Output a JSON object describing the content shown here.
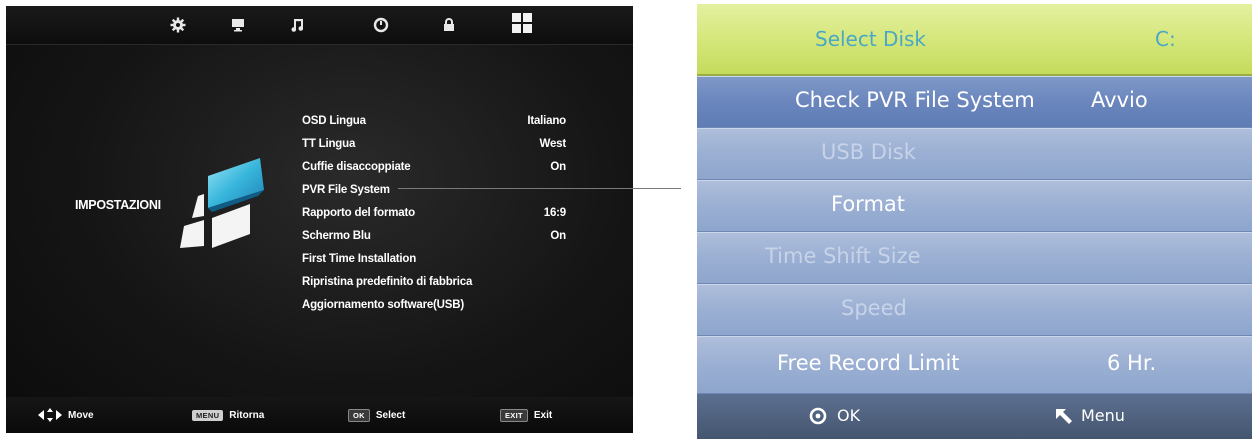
{
  "tv_screen": {
    "top_icons": [
      "gear-icon",
      "monitor-icon",
      "music-note-icon",
      "clock-icon",
      "lock-icon",
      "grid-icon"
    ],
    "section_title": "IMPOSTAZIONI",
    "menu": [
      {
        "label": "OSD Lingua",
        "value": "Italiano"
      },
      {
        "label": "TT Lingua",
        "value": "West"
      },
      {
        "label": "Cuffie disaccoppiate",
        "value": "On"
      },
      {
        "label": "PVR File System",
        "value": ""
      },
      {
        "label": "Rapporto del formato",
        "value": "16:9"
      },
      {
        "label": "Schermo Blu",
        "value": "On"
      },
      {
        "label": "First Time Installation",
        "value": ""
      },
      {
        "label": "Ripristina predefinito di fabbrica",
        "value": ""
      },
      {
        "label": "Aggiornamento software(USB)",
        "value": ""
      }
    ],
    "bottom_bar": {
      "move": "Move",
      "menu_key": "MENU",
      "menu_label": "Ritorna",
      "ok_key": "OK",
      "ok_label": "Select",
      "exit_key": "EXIT",
      "exit_label": "Exit"
    }
  },
  "pvr_panel": {
    "header": {
      "label": "Select Disk",
      "value": "C:"
    },
    "rows": [
      {
        "label": "Check PVR File System",
        "value": "Avvio",
        "state": "selected"
      },
      {
        "label": "USB Disk",
        "value": "",
        "state": "disabled"
      },
      {
        "label": "Format",
        "value": "",
        "state": "normal"
      },
      {
        "label": "Time Shift Size",
        "value": "",
        "state": "disabled"
      },
      {
        "label": "Speed",
        "value": "",
        "state": "disabled"
      },
      {
        "label": "Free Record Limit",
        "value": "6 Hr.",
        "state": "normal"
      }
    ],
    "footer": {
      "ok_label": "OK",
      "menu_label": "Menu"
    }
  },
  "colors": {
    "header_bg": "#d3e678",
    "header_text": "#4aa8c4",
    "row_bg": "#9aafd3",
    "selected_row_bg": "#6a86bd",
    "footer_bg": "#4e6180"
  }
}
